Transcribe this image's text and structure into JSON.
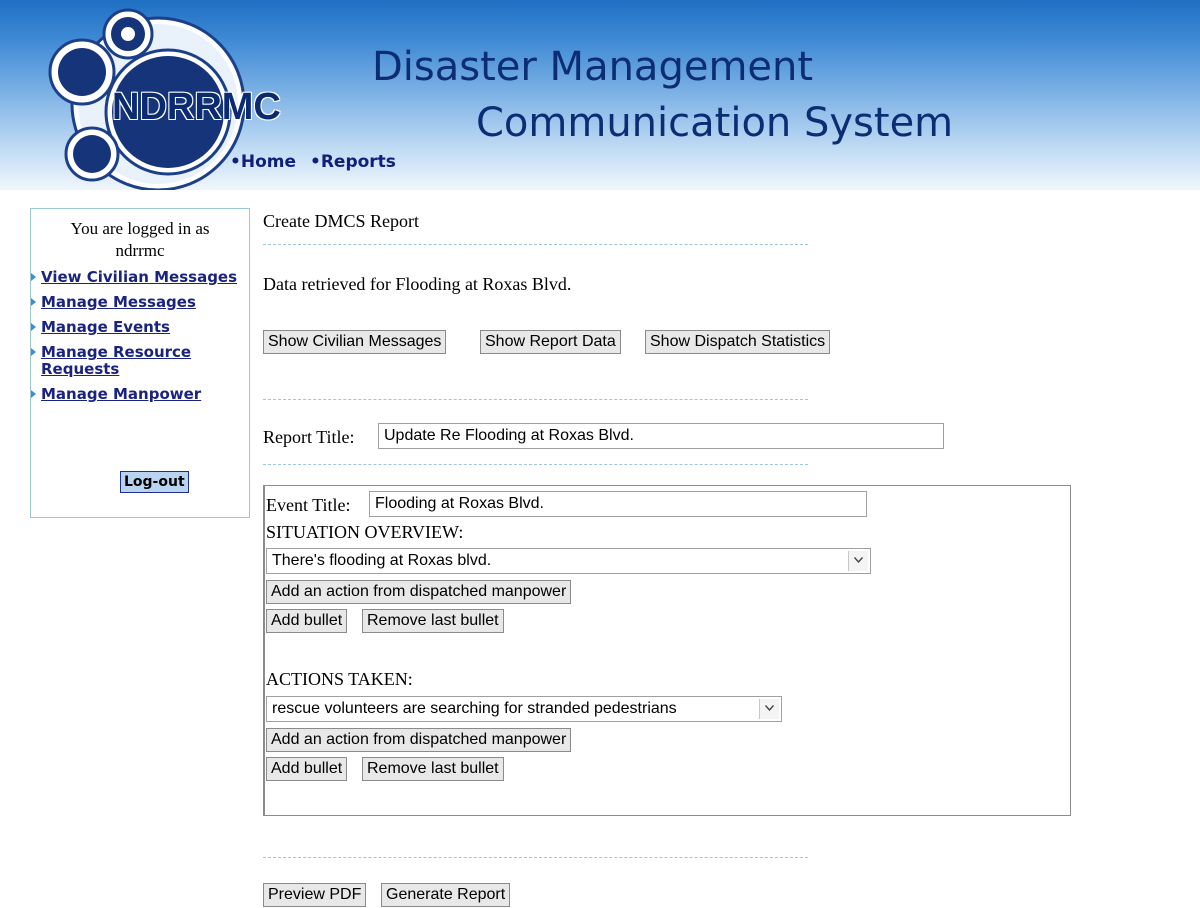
{
  "header": {
    "logo_text": "NDRRMC",
    "title_line1": "Disaster Management",
    "title_line2": "Communication System",
    "nav": [
      {
        "label": "•Home"
      },
      {
        "label": "•Reports"
      }
    ]
  },
  "sidebar": {
    "logged_in_line1": "You are logged in as",
    "logged_in_user": "ndrrmc",
    "links": [
      {
        "label": "View Civilian Messages"
      },
      {
        "label": "Manage Messages"
      },
      {
        "label": "Manage Events"
      },
      {
        "label": "Manage Resource Requests"
      },
      {
        "label": "Manage Manpower"
      }
    ],
    "logout_label": "Log-out"
  },
  "main": {
    "heading": "Create DMCS Report",
    "retrieved_text": "Data retrieved for Flooding at Roxas Blvd.",
    "buttons": {
      "show_civilian_messages": "Show Civilian Messages",
      "show_report_data": "Show Report Data",
      "show_dispatch_statistics": "Show Dispatch Statistics"
    },
    "report_title_label": "Report Title:",
    "report_title_value": "Update Re Flooding at Roxas Blvd.",
    "event": {
      "title_label": "Event Title:",
      "title_value": "Flooding at Roxas Blvd.",
      "situation_label": "SITUATION OVERVIEW:",
      "situation_selected": "There's flooding at Roxas blvd.",
      "actions_label": "ACTIONS TAKEN:",
      "actions_selected": "rescue volunteers are searching for stranded pedestrians",
      "add_action_label": "Add an action from dispatched manpower",
      "add_bullet_label": "Add bullet",
      "remove_bullet_label": "Remove last bullet"
    },
    "footer_buttons": {
      "preview_pdf": "Preview PDF",
      "generate_report": "Generate Report"
    }
  },
  "colors": {
    "header_gradient_top": "#1f6fc4",
    "title_text": "#0c2d74",
    "link": "#1a237e",
    "sidebar_border": "#9cc7d8",
    "logout_bg": "#b9d4f0"
  }
}
